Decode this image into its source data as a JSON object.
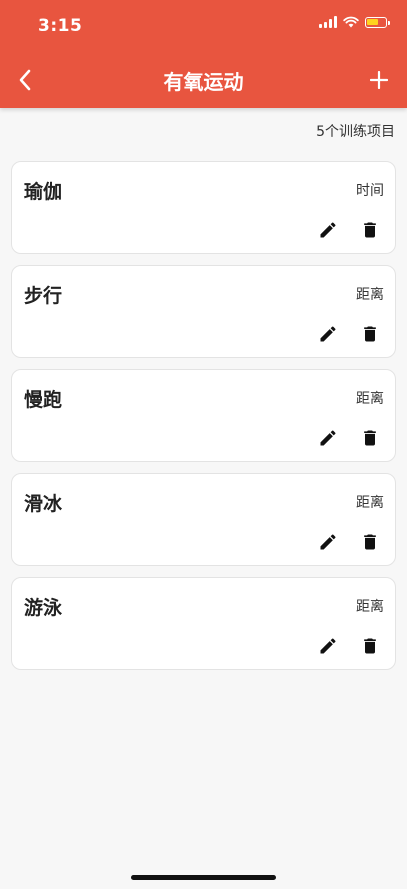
{
  "status_bar": {
    "time": "3:15"
  },
  "nav": {
    "title": "有氧运动"
  },
  "summary": {
    "count_label": "5个训练项目"
  },
  "items": [
    {
      "name": "瑜伽",
      "type": "时间"
    },
    {
      "name": "步行",
      "type": "距离"
    },
    {
      "name": "慢跑",
      "type": "距离"
    },
    {
      "name": "滑冰",
      "type": "距离"
    },
    {
      "name": "游泳",
      "type": "距离"
    }
  ],
  "colors": {
    "accent": "#e8553f",
    "battery": "#ffd21f"
  }
}
